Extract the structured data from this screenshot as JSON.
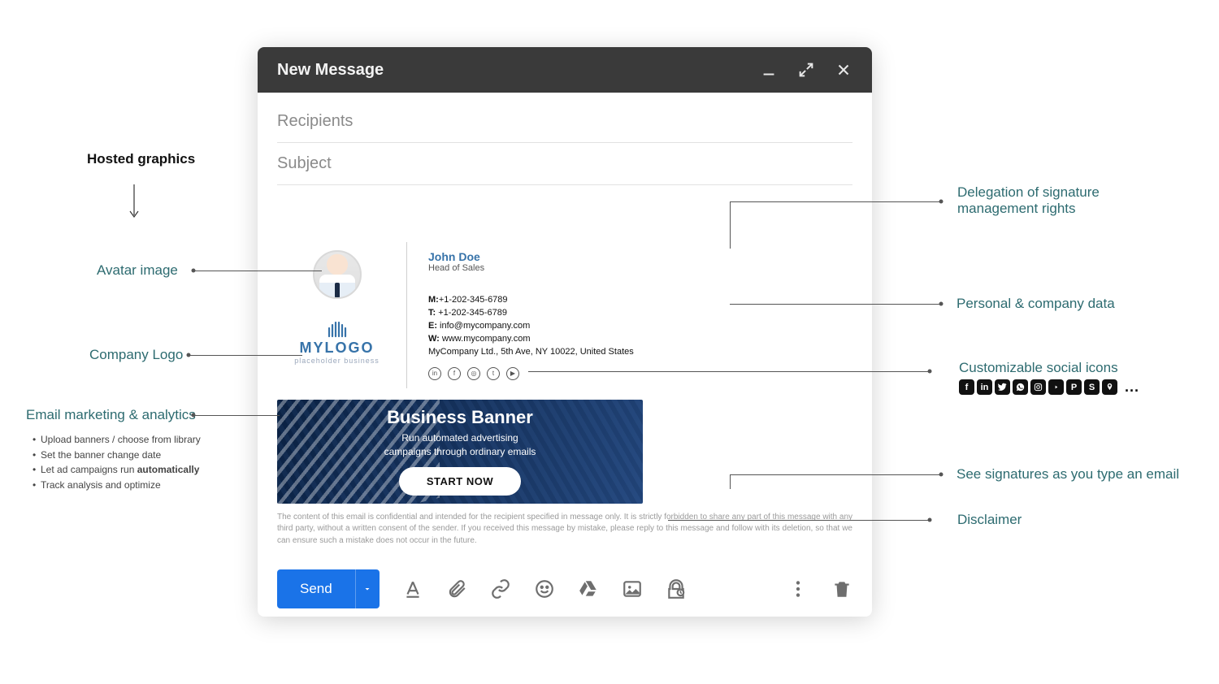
{
  "compose": {
    "title": "New Message",
    "recipients_placeholder": "Recipients",
    "subject_placeholder": "Subject",
    "send_label": "Send"
  },
  "signature": {
    "name": "John Doe",
    "title": "Head of Sales",
    "mobile_label": "M:",
    "mobile": "+1-202-345-6789",
    "tel_label": "T:",
    "tel": " +1-202-345-6789",
    "email_label": "E:",
    "email": " info@mycompany.com",
    "web_label": "W:",
    "web": " www.mycompany.com",
    "address": "MyCompany Ltd., 5th Ave, NY 10022, United States",
    "logo_text": "MYLOGO",
    "logo_tag": "placeholder business",
    "social": [
      "in",
      "f",
      "◎",
      "t",
      "▶"
    ]
  },
  "banner": {
    "title": "Business Banner",
    "sub_line1": "Run automated advertising",
    "sub_line2": "campaigns through ordinary emails",
    "cta": "START NOW"
  },
  "disclaimer": "The content of this email is confidential and intended for the recipient specified in message only. It is strictly forbidden to share any part of this message with any third party, without a written consent of the sender. If you received this message by mistake, please reply to this message and follow with its deletion, so that we can ensure such a mistake does not occur in the future.",
  "annotations": {
    "hosted_graphics": "Hosted graphics",
    "avatar_image": "Avatar image",
    "company_logo": "Company Logo",
    "email_marketing": "Email marketing & analytics",
    "bullets": {
      "b1": "Upload banners / choose from library",
      "b2": "Set the banner change date",
      "b3_pre": "Let ad campaigns run ",
      "b3_bold": "automatically",
      "b4": "Track analysis and optimize"
    },
    "delegation_l1": "Delegation of signature",
    "delegation_l2": "management rights",
    "personal_data": "Personal & company data",
    "custom_social": "Customizable social icons",
    "see_signatures": "See signatures as you type an email",
    "disclaimer_label": "Disclaimer",
    "social_more": "..."
  }
}
